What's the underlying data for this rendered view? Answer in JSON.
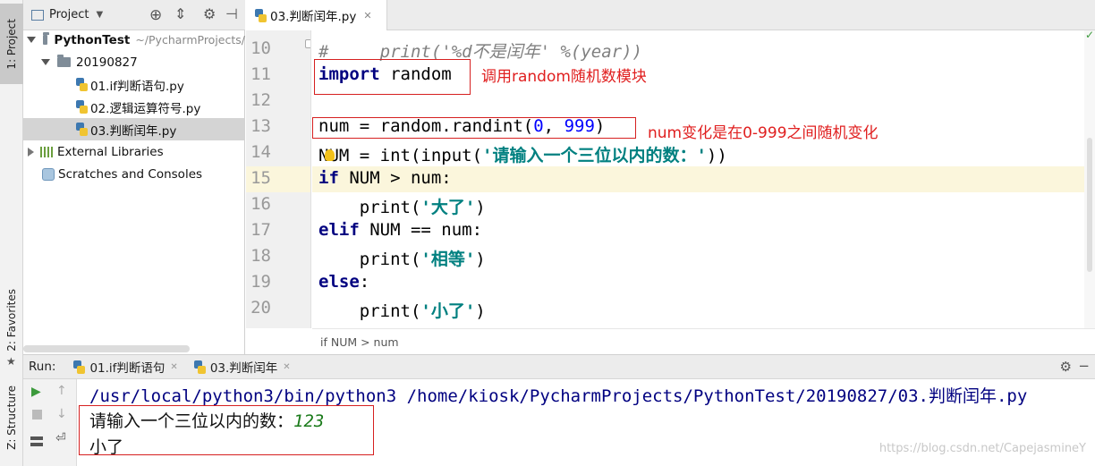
{
  "tool_strip": {
    "project_tab": "1: Project",
    "favorites_tab": "2: Favorites",
    "structure_tab": "Z: Structure"
  },
  "project_panel": {
    "title": "Project",
    "tree": {
      "root_name": "PythonTest",
      "root_path": "~/PycharmProjects/",
      "folder": "20190827",
      "files": [
        "01.if判断语句.py",
        "02.逻辑运算符号.py",
        "03.判断闰年.py"
      ],
      "external_libraries": "External Libraries",
      "scratches": "Scratches and Consoles"
    }
  },
  "editor": {
    "active_tab": "03.判断闰年.py",
    "line_numbers": [
      "10",
      "11",
      "12",
      "13",
      "14",
      "15",
      "16",
      "17",
      "18",
      "19",
      "20"
    ],
    "current_line": "15",
    "lines": {
      "l10a": "#     print(",
      "l10b": "'%d不是闰年'",
      "l10c": " %(year))",
      "l11_kw": "import",
      "l11_rest": " random",
      "l13a": "num = random.randint(",
      "l13_n1": "0",
      "l13b": ", ",
      "l13_n2": "999",
      "l13c": ")",
      "l14a": "NUM = int(input(",
      "l14_str": "'请输入一个三位以内的数：'",
      "l14c": "))",
      "l15_kw": "if",
      "l15_rest": " NUM > num:",
      "l16a": "    print(",
      "l16_str": "'大了'",
      "l16c": ")",
      "l17_kw": "elif",
      "l17_rest": " NUM == num:",
      "l18a": "    print(",
      "l18_str": "'相等'",
      "l18c": ")",
      "l19_kw": "else",
      "l19_rest": ":",
      "l20a": "    print(",
      "l20_str": "'小了'",
      "l20c": ")"
    },
    "annotations": {
      "import_note": "调用random随机数模块",
      "randint_note": "num变化是在0-999之间随机变化"
    },
    "breadcrumb": "if NUM > num"
  },
  "run_panel": {
    "label": "Run:",
    "tabs": [
      "01.if判断语句",
      "03.判断闰年"
    ],
    "console": {
      "command": "/usr/local/python3/bin/python3 /home/kiosk/PycharmProjects/PythonTest/20190827/03.判断闰年.py",
      "prompt": "请输入一个三位以内的数：",
      "user_input": "123",
      "output": "小了"
    }
  },
  "watermark": "https://blog.csdn.net/CapejasmineY",
  "colors": {
    "keyword": "#000080",
    "string": "#008080",
    "number": "#0000ff",
    "annotation_red": "#e02020",
    "current_line_bg": "#fbf6dc",
    "input_green": "#1a7a1a"
  }
}
